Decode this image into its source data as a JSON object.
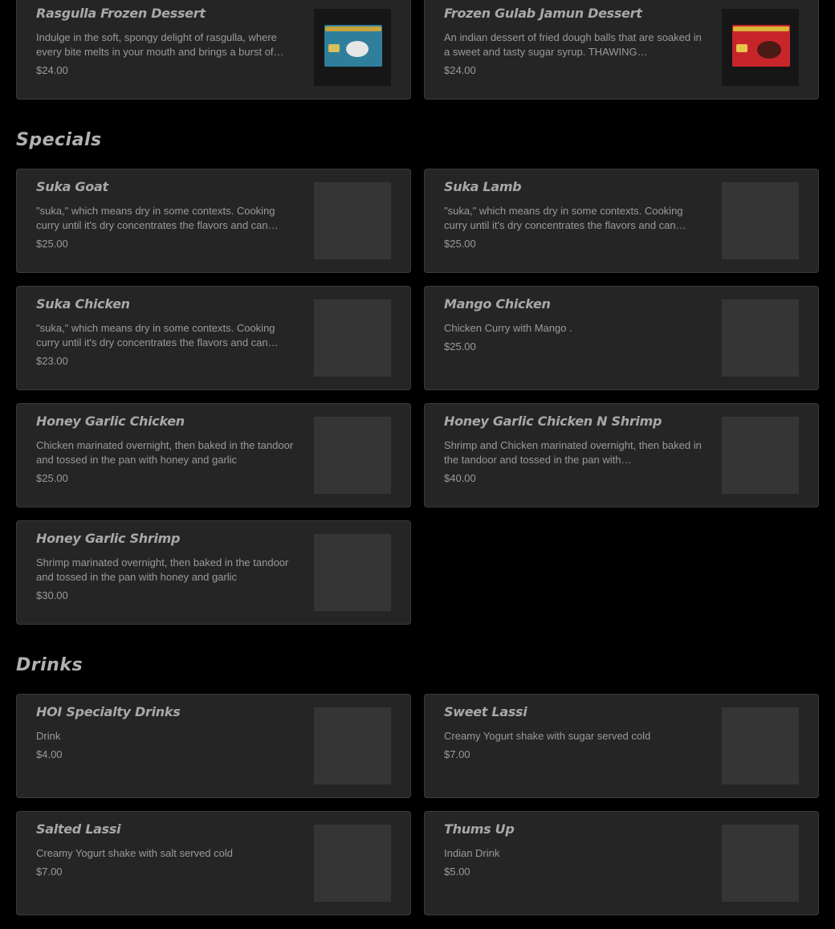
{
  "desserts": [
    {
      "name": "Rasgulla Frozen Dessert",
      "description": "Indulge in the soft, spongy delight of rasgulla, where every bite melts in your mouth and brings a burst of…",
      "price": "$24.00"
    },
    {
      "name": "Frozen Gulab Jamun Dessert",
      "description": "An indian dessert of fried dough balls that are soaked in a sweet and tasty sugar syrup. THAWING…",
      "price": "$24.00"
    }
  ],
  "specials": {
    "title": "Specials",
    "items": [
      {
        "name": "Suka Goat",
        "description": "\"suka,\" which means dry in some contexts. Cooking curry until it's dry concentrates the flavors and can…",
        "price": "$25.00"
      },
      {
        "name": "Suka Lamb",
        "description": "\"suka,\" which means dry in some contexts. Cooking curry until it's dry concentrates the flavors and can…",
        "price": "$25.00"
      },
      {
        "name": "Suka Chicken",
        "description": "\"suka,\" which means dry in some contexts. Cooking curry until it's dry concentrates the flavors and can…",
        "price": "$23.00"
      },
      {
        "name": "Mango Chicken",
        "description": "Chicken Curry with Mango .",
        "price": "$25.00"
      },
      {
        "name": "Honey Garlic Chicken",
        "description": "Chicken marinated overnight, then baked in the tandoor and tossed in the pan with honey and garlic",
        "price": "$25.00"
      },
      {
        "name": "Honey Garlic Chicken N Shrimp",
        "description": "Shrimp and Chicken marinated overnight, then baked in the tandoor and tossed in the pan with…",
        "price": "$40.00"
      },
      {
        "name": "Honey Garlic Shrimp",
        "description": "Shrimp marinated overnight, then baked in the tandoor and tossed in the pan with honey and garlic",
        "price": "$30.00"
      }
    ]
  },
  "drinks": {
    "title": "Drinks",
    "items": [
      {
        "name": "HOI Specialty Drinks",
        "description": "Drink",
        "price": "$4.00"
      },
      {
        "name": "Sweet Lassi",
        "description": "Creamy Yogurt shake with sugar served cold",
        "price": "$7.00"
      },
      {
        "name": "Salted Lassi",
        "description": "Creamy Yogurt shake with salt served cold",
        "price": "$7.00"
      },
      {
        "name": "Thums Up",
        "description": "Indian Drink",
        "price": "$5.00"
      }
    ]
  },
  "colors": {
    "background": "#000000",
    "card": "#252525",
    "card_border": "#3a3a3a",
    "image_placeholder": "#353535",
    "title_text": "#a8a8a8",
    "body_text": "#9a9a9a"
  }
}
